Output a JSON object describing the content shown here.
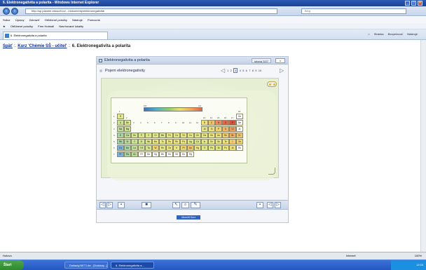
{
  "window": {
    "title": "6. Elektronegativita a polarita - Windows Internet Explorer"
  },
  "address": {
    "domain": "planete.edusoft.cz",
    "url": "http://sp.planete.edusoft.cz/.../dokumenty/elektronegativita/"
  },
  "search": {
    "placeholder": "Bing"
  },
  "menu": [
    "Súbor",
    "Úpravy",
    "Zobraziť",
    "Obľúbené položky",
    "Nástroje",
    "Pomocník"
  ],
  "favorites": {
    "label": "Obľúbené položky",
    "items": [
      "Free Hotmail",
      "Navrhované lokality"
    ]
  },
  "tab": {
    "label": "6. Elektronegativita a polarita"
  },
  "toolbar_right": [
    "Stránka",
    "Bezpečnosť",
    "Nástroje"
  ],
  "breadcrumb": {
    "back": "Späť",
    "course": "Kurz 'Chémie SŠ - učitel'",
    "current": "6. Elektronegativita a polarita"
  },
  "module": {
    "title": "Elektronegativita a polarita",
    "page_label": "strana 3/27",
    "subtitle": "Pojem elektronegativity",
    "pages": [
      "1",
      "2",
      "3",
      "4",
      "5",
      "6",
      "7",
      "8",
      "9",
      "10"
    ],
    "current_page": "3"
  },
  "periodic_table": {
    "legend_low": "0,8",
    "legend_high": "4,0",
    "groups": [
      "1",
      "2",
      "3",
      "4",
      "5",
      "6",
      "7",
      "8",
      "9",
      "10",
      "11",
      "12",
      "13",
      "14",
      "15",
      "16",
      "17",
      "18"
    ],
    "periods": [
      "1",
      "2",
      "3",
      "4",
      "5",
      "6",
      "7"
    ],
    "elements": [
      {
        "s": "H",
        "p": 1,
        "g": 1,
        "c": "#e4ea8a"
      },
      {
        "s": "He",
        "p": 1,
        "g": 18,
        "c": "#ffffff"
      },
      {
        "s": "Li",
        "p": 2,
        "g": 1,
        "c": "#cbe394"
      },
      {
        "s": "Be",
        "p": 2,
        "g": 2,
        "c": "#d8e78e"
      },
      {
        "s": "B",
        "p": 2,
        "g": 13,
        "c": "#efe57a"
      },
      {
        "s": "C",
        "p": 2,
        "g": 14,
        "c": "#f0c26a"
      },
      {
        "s": "N",
        "p": 2,
        "g": 15,
        "c": "#ea8d5e"
      },
      {
        "s": "O",
        "p": 2,
        "g": 16,
        "c": "#e06a50"
      },
      {
        "s": "F",
        "p": 2,
        "g": 17,
        "c": "#d9503f"
      },
      {
        "s": "Ne",
        "p": 2,
        "g": 18,
        "c": "#ffffff"
      },
      {
        "s": "Na",
        "p": 3,
        "g": 1,
        "c": "#b8dc9a"
      },
      {
        "s": "Mg",
        "p": 3,
        "g": 2,
        "c": "#cce394"
      },
      {
        "s": "Al",
        "p": 3,
        "g": 13,
        "c": "#e2e886"
      },
      {
        "s": "Si",
        "p": 3,
        "g": 14,
        "c": "#ebe67e"
      },
      {
        "s": "P",
        "p": 3,
        "g": 15,
        "c": "#f0d46e"
      },
      {
        "s": "S",
        "p": 3,
        "g": 16,
        "c": "#f0b866"
      },
      {
        "s": "Cl",
        "p": 3,
        "g": 17,
        "c": "#ec9a5e"
      },
      {
        "s": "Ar",
        "p": 3,
        "g": 18,
        "c": "#ffffff"
      },
      {
        "s": "K",
        "p": 4,
        "g": 1,
        "c": "#a8d4a6"
      },
      {
        "s": "Ca",
        "p": 4,
        "g": 2,
        "c": "#bcdc98"
      },
      {
        "s": "Sc",
        "p": 4,
        "g": 3,
        "c": "#d4e68e"
      },
      {
        "s": "Ti",
        "p": 4,
        "g": 4,
        "c": "#dbe78a"
      },
      {
        "s": "V",
        "p": 4,
        "g": 5,
        "c": "#dfe888"
      },
      {
        "s": "Cr",
        "p": 4,
        "g": 6,
        "c": "#e1e886"
      },
      {
        "s": "Mn",
        "p": 4,
        "g": 7,
        "c": "#dbe78a"
      },
      {
        "s": "Fe",
        "p": 4,
        "g": 8,
        "c": "#e6e983"
      },
      {
        "s": "Co",
        "p": 4,
        "g": 9,
        "c": "#e6e983"
      },
      {
        "s": "Ni",
        "p": 4,
        "g": 10,
        "c": "#e6e983"
      },
      {
        "s": "Cu",
        "p": 4,
        "g": 11,
        "c": "#e6e983"
      },
      {
        "s": "Zn",
        "p": 4,
        "g": 12,
        "c": "#dde788"
      },
      {
        "s": "Ga",
        "p": 4,
        "g": 13,
        "c": "#e6e983"
      },
      {
        "s": "Ge",
        "p": 4,
        "g": 14,
        "c": "#ebe67e"
      },
      {
        "s": "As",
        "p": 4,
        "g": 15,
        "c": "#efe078"
      },
      {
        "s": "Se",
        "p": 4,
        "g": 16,
        "c": "#f0cc6c"
      },
      {
        "s": "Br",
        "p": 4,
        "g": 17,
        "c": "#efae62"
      },
      {
        "s": "Kr",
        "p": 4,
        "g": 18,
        "c": "#f0c26a"
      },
      {
        "s": "Rb",
        "p": 5,
        "g": 1,
        "c": "#a4d2a8"
      },
      {
        "s": "Sr",
        "p": 5,
        "g": 2,
        "c": "#b4da9c"
      },
      {
        "s": "Y",
        "p": 5,
        "g": 3,
        "c": "#c8e294"
      },
      {
        "s": "Zr",
        "p": 5,
        "g": 4,
        "c": "#d4e68e"
      },
      {
        "s": "Nb",
        "p": 5,
        "g": 5,
        "c": "#dbe78a"
      },
      {
        "s": "Mo",
        "p": 5,
        "g": 6,
        "c": "#ede77c"
      },
      {
        "s": "Tc",
        "p": 5,
        "g": 7,
        "c": "#e6e983"
      },
      {
        "s": "Ru",
        "p": 5,
        "g": 8,
        "c": "#ede77c"
      },
      {
        "s": "Rh",
        "p": 5,
        "g": 9,
        "c": "#ede77c"
      },
      {
        "s": "Pd",
        "p": 5,
        "g": 10,
        "c": "#ede77c"
      },
      {
        "s": "Ag",
        "p": 5,
        "g": 11,
        "c": "#e1e886"
      },
      {
        "s": "Cd",
        "p": 5,
        "g": 12,
        "c": "#dde788"
      },
      {
        "s": "In",
        "p": 5,
        "g": 13,
        "c": "#e1e886"
      },
      {
        "s": "Sn",
        "p": 5,
        "g": 14,
        "c": "#e6e983"
      },
      {
        "s": "Sb",
        "p": 5,
        "g": 15,
        "c": "#ebe67e"
      },
      {
        "s": "Te",
        "p": 5,
        "g": 16,
        "c": "#efe078"
      },
      {
        "s": "I",
        "p": 5,
        "g": 17,
        "c": "#f0cc6c"
      },
      {
        "s": "Xe",
        "p": 5,
        "g": 18,
        "c": "#f0d46e"
      },
      {
        "s": "Cs",
        "p": 6,
        "g": 1,
        "c": "#7fb0dc"
      },
      {
        "s": "Ba",
        "p": 6,
        "g": 2,
        "c": "#a8d4a6"
      },
      {
        "s": "La",
        "p": 6,
        "g": 3,
        "c": "#c0de96"
      },
      {
        "s": "Hf",
        "p": 6,
        "g": 4,
        "c": "#cce394"
      },
      {
        "s": "Ta",
        "p": 6,
        "g": 5,
        "c": "#d4e68e"
      },
      {
        "s": "W",
        "p": 6,
        "g": 6,
        "c": "#f0d46e"
      },
      {
        "s": "Re",
        "p": 6,
        "g": 7,
        "c": "#e6e983"
      },
      {
        "s": "Os",
        "p": 6,
        "g": 8,
        "c": "#ebe67e"
      },
      {
        "s": "Ir",
        "p": 6,
        "g": 9,
        "c": "#ebe67e"
      },
      {
        "s": "Pt",
        "p": 6,
        "g": 10,
        "c": "#f0d46e"
      },
      {
        "s": "Au",
        "p": 6,
        "g": 11,
        "c": "#f0c26a"
      },
      {
        "s": "Hg",
        "p": 6,
        "g": 12,
        "c": "#ebe67e"
      },
      {
        "s": "Tl",
        "p": 6,
        "g": 13,
        "c": "#e1e886"
      },
      {
        "s": "Pb",
        "p": 6,
        "g": 14,
        "c": "#e6e983"
      },
      {
        "s": "Bi",
        "p": 6,
        "g": 15,
        "c": "#e1e886"
      },
      {
        "s": "Po",
        "p": 6,
        "g": 16,
        "c": "#ebe67e"
      },
      {
        "s": "At",
        "p": 6,
        "g": 17,
        "c": "#efe078"
      },
      {
        "s": "Rn",
        "p": 6,
        "g": 18,
        "c": "#ffffff"
      },
      {
        "s": "Fr",
        "p": 7,
        "g": 1,
        "c": "#7fb0dc"
      },
      {
        "s": "Ra",
        "p": 7,
        "g": 2,
        "c": "#a8d4a6"
      },
      {
        "s": "Ac",
        "p": 7,
        "g": 3,
        "c": "#bcdc98"
      },
      {
        "s": "Rf",
        "p": 7,
        "g": 4,
        "c": "#ffffff"
      },
      {
        "s": "Db",
        "p": 7,
        "g": 5,
        "c": "#ffffff"
      },
      {
        "s": "Sg",
        "p": 7,
        "g": 6,
        "c": "#ffffff"
      },
      {
        "s": "Bh",
        "p": 7,
        "g": 7,
        "c": "#ffffff"
      },
      {
        "s": "Hs",
        "p": 7,
        "g": 8,
        "c": "#ffffff"
      },
      {
        "s": "Mt",
        "p": 7,
        "g": 9,
        "c": "#ffffff"
      },
      {
        "s": "Ds",
        "p": 7,
        "g": 10,
        "c": "#ffffff"
      },
      {
        "s": "Rg",
        "p": 7,
        "g": 11,
        "c": "#ffffff"
      }
    ]
  },
  "blue_button": {
    "label": "Ukončiť Kurz"
  },
  "status": {
    "left": "Hotovo",
    "zone": "Internet",
    "zoom": "100%"
  },
  "taskbar": {
    "start": "Štart",
    "tasks": [
      "Doklady.NET Lite - [Doklady...]",
      "6. Elektronegativita a..."
    ],
    "clock": "12:00"
  }
}
